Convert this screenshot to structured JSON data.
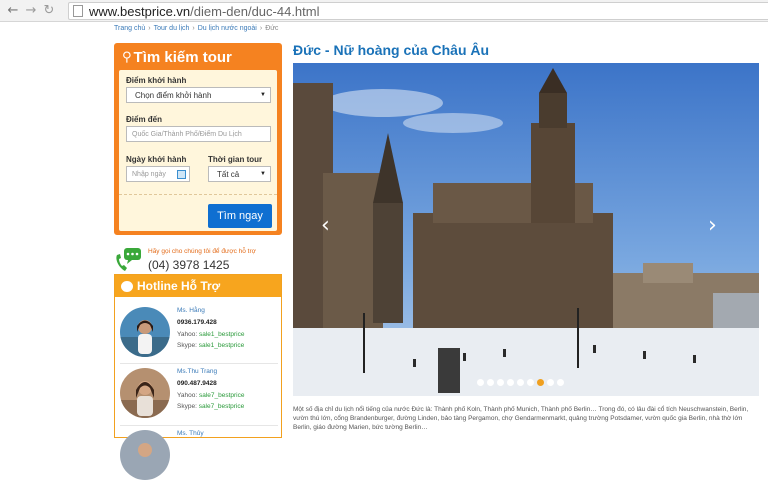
{
  "browser": {
    "url_domain": "www.bestprice.vn",
    "url_path": "/diem-den/duc-44.html"
  },
  "breadcrumb": {
    "items": [
      "Trang chủ",
      "Tour du lịch",
      "Du lịch nước ngoài"
    ],
    "current": "Đức"
  },
  "search": {
    "title": "Tìm kiếm tour",
    "departure_label": "Điểm khởi hành",
    "departure_value": "Chọn điểm khởi hành",
    "destination_label": "Điểm đến",
    "destination_placeholder": "Quốc Gia/Thành Phố/Điểm Du Lịch",
    "date_label": "Ngày khởi hành",
    "date_placeholder": "Nhập ngày",
    "duration_label": "Thời gian tour",
    "duration_value": "Tất cả",
    "button": "Tìm ngay"
  },
  "support": {
    "text": "Hãy gọi cho chúng tôi để được hỗ trợ",
    "phone": "(04) 3978 1425"
  },
  "hotline": {
    "title": "Hotline Hỗ Trợ",
    "agents": [
      {
        "name": "Ms. Hằng",
        "phone": "0936.179.428",
        "yahoo_label": "Yahoo:",
        "yahoo": "sale1_bestprice",
        "skype_label": "Skype:",
        "skype": "sale1_bestprice"
      },
      {
        "name": "Ms.Thu Trang",
        "phone": "090.487.9428",
        "yahoo_label": "Yahoo:",
        "yahoo": "sale7_bestprice",
        "skype_label": "Skype:",
        "skype": "sale7_bestprice"
      },
      {
        "name": "Ms. Thủy"
      }
    ]
  },
  "main": {
    "title": "Đức - Nữ hoàng của Châu Âu",
    "slides_total": 9,
    "slide_active": 7,
    "description": "Một số địa chỉ du lịch nổi tiếng của nước Đức là: Thành phố Koln, Thành phố Munich, Thành phố Berlin… Trong đó, có lâu đài cổ tích Neuschwanstein, Berlin, vườn thú lớn, cổng Brandenburger, đường Linden, bảo tàng Pergamon, chợ Gendarmenmarkt, quảng trường Potsdamer, vườn quốc gia Berlin, nhà thờ lớn Berlin, giáo đường Marien, bức tường Berlin…"
  },
  "colors": {
    "accent_orange": "#f58220",
    "hotline_orange": "#f7a51e",
    "button_blue": "#0f6fd1",
    "title_blue": "#1a72b8"
  }
}
